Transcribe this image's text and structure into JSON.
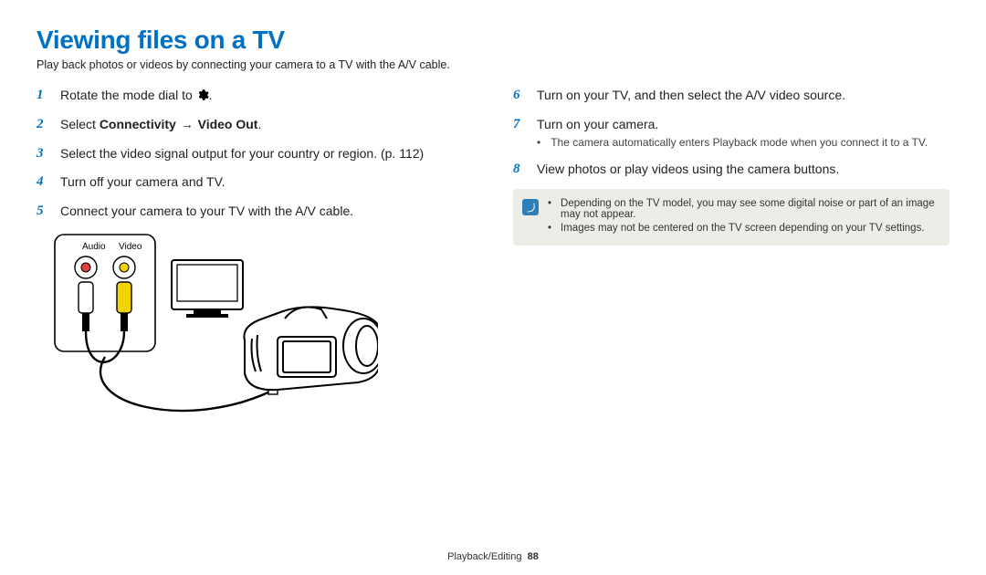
{
  "title": "Viewing files on a TV",
  "subtitle": "Play back photos or videos by connecting your camera to a TV with the A/V cable.",
  "left_steps": [
    {
      "n": "1",
      "pre": "Rotate the mode dial to ",
      "post": "."
    },
    {
      "n": "2",
      "pre": "Select ",
      "bold1": "Connectivity",
      "mid": " → ",
      "bold2": "Video Out",
      "post": "."
    },
    {
      "n": "3",
      "plain": "Select the video signal output for your country or region. (p. 112)"
    },
    {
      "n": "4",
      "plain": "Turn off your camera and TV."
    },
    {
      "n": "5",
      "plain": "Connect your camera to your TV with the A/V cable."
    }
  ],
  "figure": {
    "audio": "Audio",
    "video": "Video"
  },
  "right_steps": [
    {
      "n": "6",
      "plain": "Turn on your TV, and then select the A/V video source."
    },
    {
      "n": "7",
      "plain": "Turn on your camera.",
      "sub": "The camera automatically enters Playback mode when you connect it to a TV."
    },
    {
      "n": "8",
      "plain": "View photos or play videos using the camera buttons."
    }
  ],
  "notes": [
    "Depending on the TV model, you may see some digital noise or part of an image may not appear.",
    "Images may not be centered on the TV screen depending on your TV settings."
  ],
  "footer_section": "Playback/Editing",
  "footer_page": "88"
}
